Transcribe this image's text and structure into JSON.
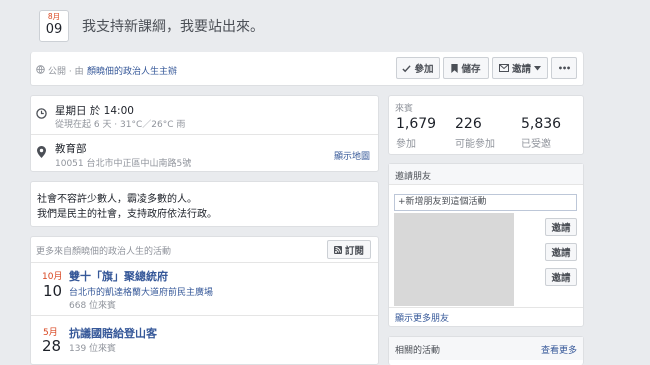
{
  "header": {
    "date_month": "8月",
    "date_day": "09",
    "title": "我支持新課綱，我要站出來。",
    "privacy": "公開 · 由",
    "host_label": "顏曉佃的政治人生主辦",
    "buttons": {
      "join": "參加",
      "save": "儲存",
      "invite": "邀請",
      "more": "•••"
    }
  },
  "details": {
    "time_line1": "星期日 於 14:00",
    "time_line2": "從現在起 6 天 · 31°C／26°C 雨",
    "place_name": "教育部",
    "place_address": "10051 台北市中正區中山南路5號",
    "show_map": "顯示地圖"
  },
  "description": {
    "line1": "社會不容許少數人，霸凌多數的人。",
    "line2": "我們是民主的社會，支持政府依法行政。"
  },
  "more_events": {
    "header": "更多來自顏曉佃的政治人生的活動",
    "subscribe": "訂閱",
    "items": [
      {
        "month": "10月",
        "day": "10",
        "title": "雙十「旗」聚總統府",
        "location_link": "台北市",
        "location_rest": "的凱達格蘭大道府前民主廣場",
        "guests": "668 位來賓"
      },
      {
        "month": "5月",
        "day": "28",
        "title": "抗議國賠給登山客",
        "guests": "139 位來賓"
      }
    ]
  },
  "guests": {
    "header": "來賓",
    "stats": [
      {
        "value": "1,679",
        "label": "參加"
      },
      {
        "value": "226",
        "label": "可能參加"
      },
      {
        "value": "5,836",
        "label": "已受邀"
      }
    ]
  },
  "invite": {
    "header": "邀請朋友",
    "placeholder": "+新增朋友到這個活動",
    "invite_label": "邀請",
    "show_more": "顯示更多朋友"
  },
  "related": {
    "header": "相關的活動",
    "see_more": "查看更多"
  },
  "colors": {
    "accent": "#d8451f",
    "link": "#365899",
    "background": "#e9ebee"
  }
}
